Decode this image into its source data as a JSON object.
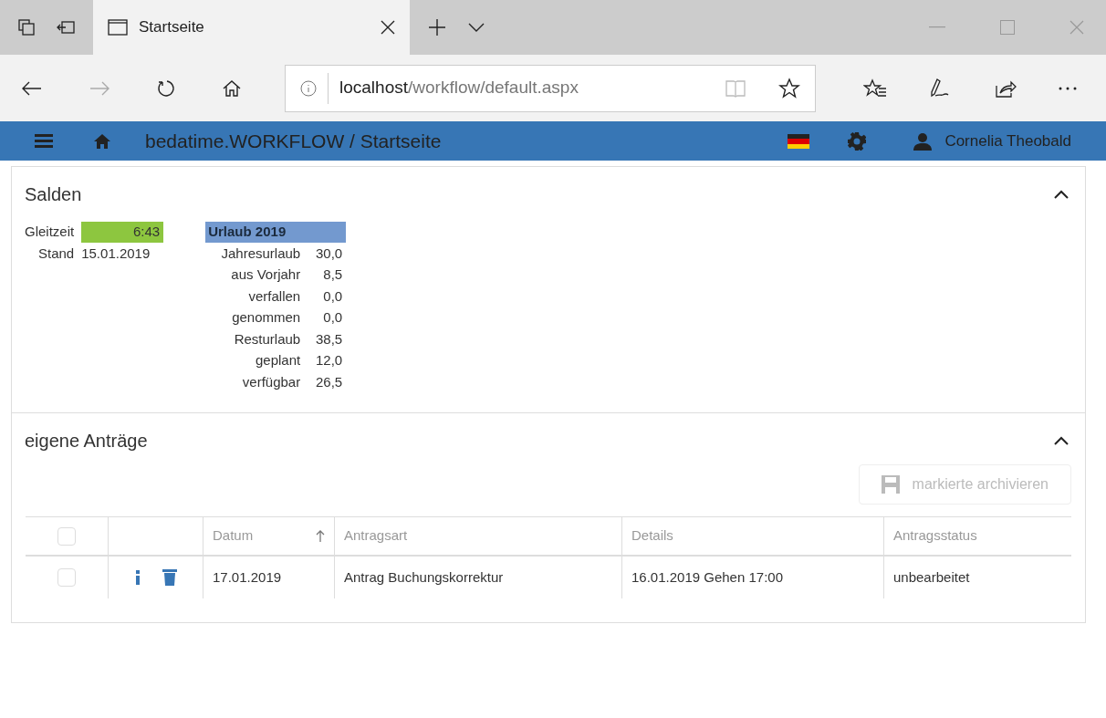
{
  "browser": {
    "tab": {
      "title": "Startseite",
      "selected": true
    },
    "address": {
      "host": "localhost",
      "path": "/workflow/default.aspx"
    },
    "favorite": false
  },
  "app": {
    "title": "bedatime.WORKFLOW / Startseite",
    "user": "Cornelia Theobald"
  },
  "salden": {
    "title": "Salden",
    "expanded": true,
    "gleitzeit": [
      {
        "label": "Gleitzeit",
        "value": "6:43",
        "kind": "highlight"
      },
      {
        "label": "Stand",
        "value": "15.01.2019",
        "kind": "plain"
      }
    ],
    "urlaub": {
      "heading": "Urlaub 2019",
      "rows": [
        {
          "label": "Jahresurlaub",
          "value": "30,0"
        },
        {
          "label": "aus Vorjahr",
          "value": "8,5"
        },
        {
          "label": "verfallen",
          "value": "0,0"
        },
        {
          "label": "genommen",
          "value": "0,0"
        },
        {
          "label": "Resturlaub",
          "value": "38,5"
        },
        {
          "label": "geplant",
          "value": "12,0"
        },
        {
          "label": "verfügbar",
          "value": "26,5"
        }
      ]
    }
  },
  "antraege": {
    "title": "eigene Anträge",
    "expanded": true,
    "archive_button": {
      "label": "markierte archivieren",
      "disabled": true
    },
    "table": {
      "header_checked": false,
      "columns": [
        {
          "label": "Datum",
          "sorted": true
        },
        {
          "label": "Antragsart",
          "sorted": false
        },
        {
          "label": "Details",
          "sorted": false
        },
        {
          "label": "Antragsstatus",
          "sorted": false
        }
      ],
      "rows": [
        {
          "checked": false,
          "cells": [
            "17.01.2019",
            "Antrag Buchungskorrektur",
            "16.01.2019 Gehen 17:00",
            "unbearbeitet"
          ]
        }
      ]
    }
  }
}
